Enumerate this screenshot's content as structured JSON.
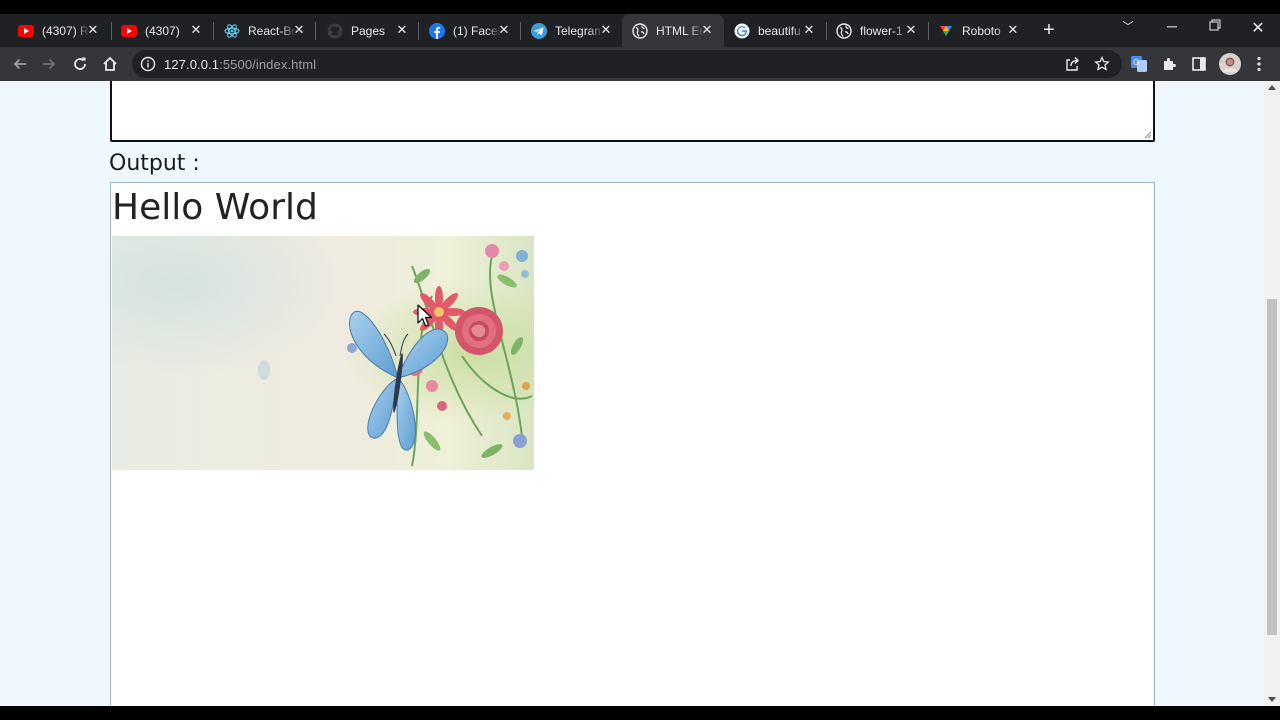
{
  "browser": {
    "tabs": [
      {
        "title": "(4307) R",
        "icon": "youtube-icon"
      },
      {
        "title": "(4307) ",
        "icon": "youtube-icon"
      },
      {
        "title": "React-Bo",
        "icon": "react-icon"
      },
      {
        "title": "Pages",
        "icon": "github-icon"
      },
      {
        "title": "(1) Faceb",
        "icon": "facebook-icon"
      },
      {
        "title": "Telegram",
        "icon": "telegram-icon"
      },
      {
        "title": "HTML Ed",
        "icon": "globe-icon",
        "active": true
      },
      {
        "title": "beautifu",
        "icon": "google-icon"
      },
      {
        "title": "flower-1",
        "icon": "globe-icon"
      },
      {
        "title": "Roboto",
        "icon": "figma-icon"
      }
    ],
    "new_tab": "+",
    "address": {
      "host": "127.0.0.1",
      "rest": ":5500/index.html"
    }
  },
  "page": {
    "output_label": "Output :",
    "output_heading": "Hello World",
    "image_description": "watercolor-butterfly-and-flowers"
  },
  "colors": {
    "tab_strip": "#202124",
    "toolbar": "#35363a",
    "page_background": "#f0f8ff",
    "output_border": "#9bb8c8"
  }
}
